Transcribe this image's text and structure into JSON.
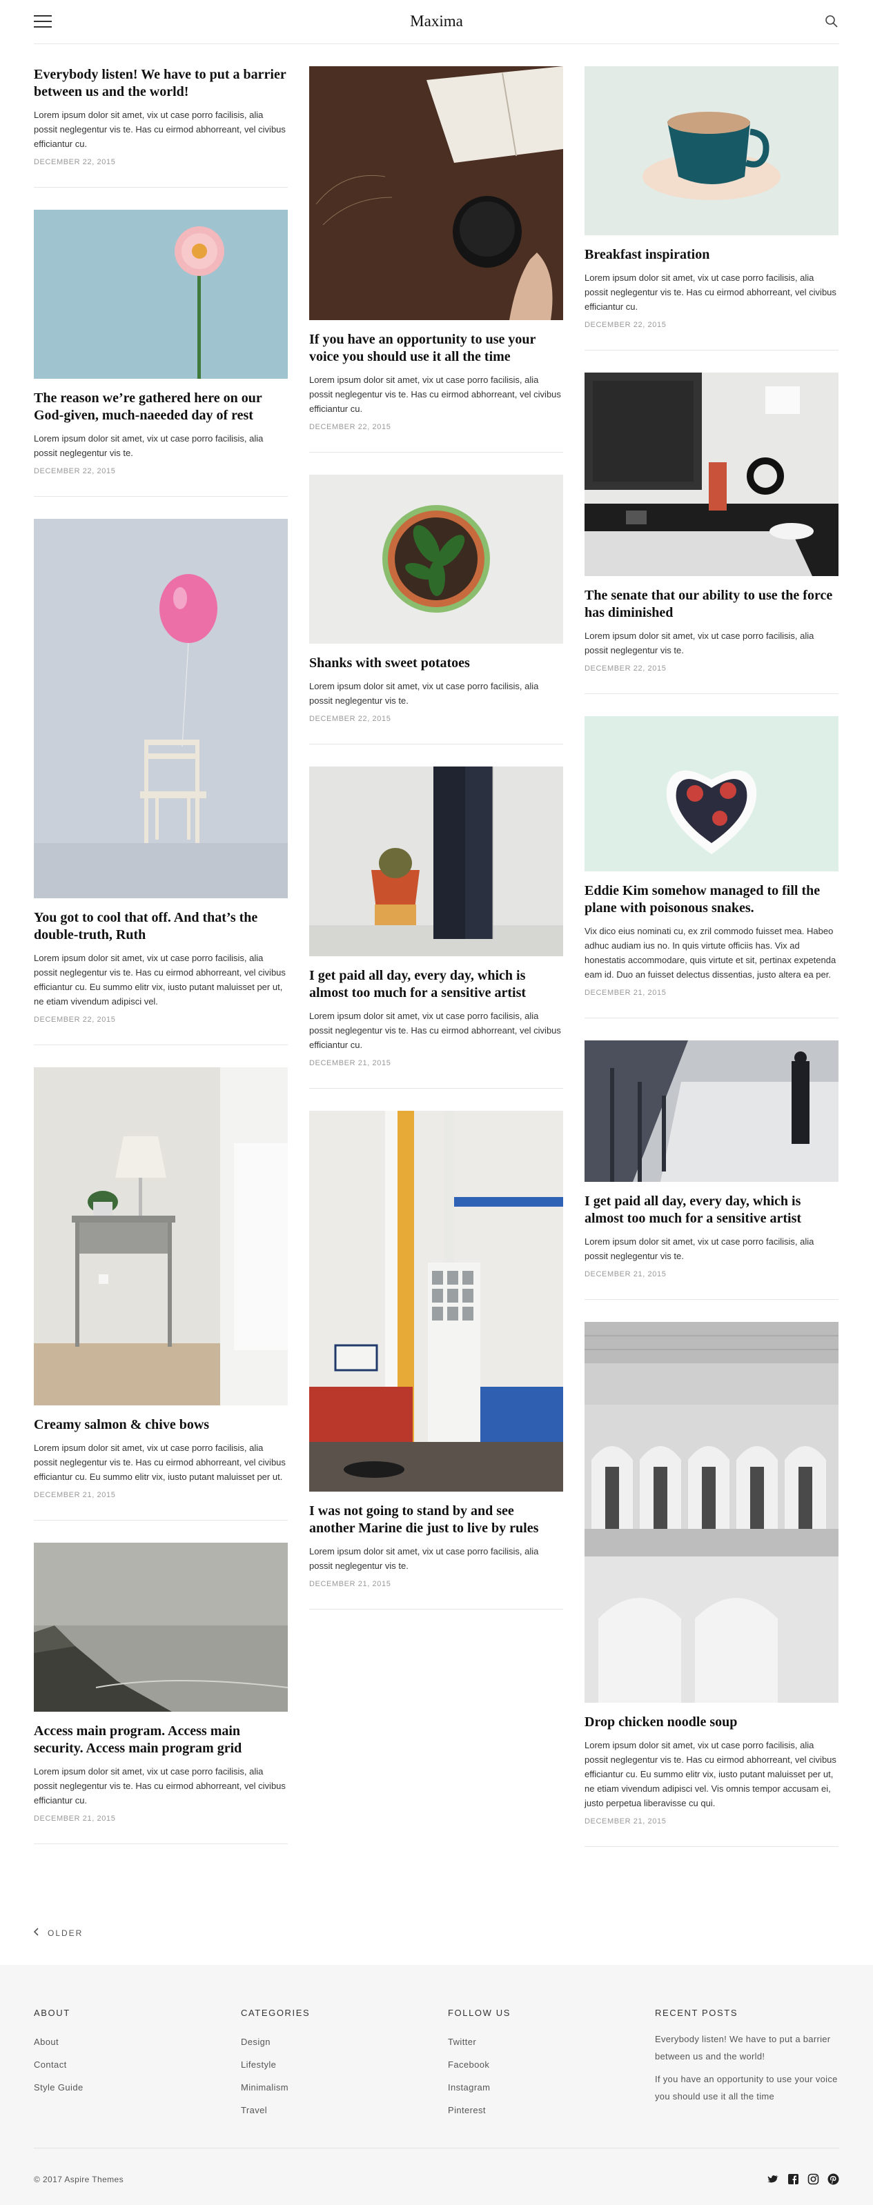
{
  "header": {
    "site_title": "Maxima",
    "menu_icon": "hamburger-menu-icon",
    "search_icon": "search-icon"
  },
  "posts": {
    "col1": [
      {
        "title": "Everybody listen! We have to put a barrier between us and the world!",
        "excerpt": "Lorem ipsum dolor sit amet, vix ut case porro facilisis, alia possit neglegentur vis te. Has cu eirmod abhorreant, vel civibus efficiantur cu.",
        "date": "December 22, 2015"
      },
      {
        "title": "The reason we’re gathered here on our God-given, much-naeeded day of rest",
        "excerpt": "Lorem ipsum dolor sit amet, vix ut case porro facilisis, alia possit neglegentur vis te.",
        "date": "December 22, 2015"
      },
      {
        "title": "You got to cool that off. And that’s the double-truth, Ruth",
        "excerpt": "Lorem ipsum dolor sit amet, vix ut case porro facilisis, alia possit neglegentur vis te. Has cu eirmod abhorreant, vel civibus efficiantur cu. Eu summo elitr vix, iusto putant maluisset per ut, ne etiam vivendum adipisci vel.",
        "date": "December 22, 2015"
      },
      {
        "title": "Creamy salmon & chive bows",
        "excerpt": "Lorem ipsum dolor sit amet, vix ut case porro facilisis, alia possit neglegentur vis te. Has cu eirmod abhorreant, vel civibus efficiantur cu. Eu summo elitr vix, iusto putant maluisset per ut.",
        "date": "December 21, 2015"
      },
      {
        "title": "Access main program. Access main security. Access main program grid",
        "excerpt": "Lorem ipsum dolor sit amet, vix ut case porro facilisis, alia possit neglegentur vis te. Has cu eirmod abhorreant, vel civibus efficiantur cu.",
        "date": "December 21, 2015"
      }
    ],
    "col2": [
      {
        "title": "If you have an opportunity to use your voice you should use it all the time",
        "excerpt": "Lorem ipsum dolor sit amet, vix ut case porro facilisis, alia possit neglegentur vis te. Has cu eirmod abhorreant, vel civibus efficiantur cu.",
        "date": "December 22, 2015"
      },
      {
        "title": "Shanks with sweet potatoes",
        "excerpt": "Lorem ipsum dolor sit amet, vix ut case porro facilisis, alia possit neglegentur vis te.",
        "date": "December 22, 2015"
      },
      {
        "title": "I get paid all day, every day, which is almost too much for a sensitive artist",
        "excerpt": "Lorem ipsum dolor sit amet, vix ut case porro facilisis, alia possit neglegentur vis te. Has cu eirmod abhorreant, vel civibus efficiantur cu.",
        "date": "December 21, 2015"
      },
      {
        "title": "I was not going to stand by and see another Marine die just to live by rules",
        "excerpt": "Lorem ipsum dolor sit amet, vix ut case porro facilisis, alia possit neglegentur vis te.",
        "date": "December 21, 2015"
      }
    ],
    "col3": [
      {
        "title": "Breakfast inspiration",
        "excerpt": "Lorem ipsum dolor sit amet, vix ut case porro facilisis, alia possit neglegentur vis te. Has cu eirmod abhorreant, vel civibus efficiantur cu.",
        "date": "December 22, 2015"
      },
      {
        "title": "The senate that our ability to use the force has diminished",
        "excerpt": "Lorem ipsum dolor sit amet, vix ut case porro facilisis, alia possit neglegentur vis te.",
        "date": "December 22, 2015"
      },
      {
        "title": "Eddie Kim somehow managed to fill the plane with poisonous snakes.",
        "excerpt": "Vix dico eius nominati cu, ex zril commodo fuisset mea. Habeo adhuc audiam ius no. In quis virtute officiis has. Vix ad honestatis accommodare, quis virtute et sit, pertinax expetenda eam id. Duo an fuisset delectus dissentias, justo altera ea per.",
        "date": "December 21, 2015"
      },
      {
        "title": "I get paid all day, every day, which is almost too much for a sensitive artist",
        "excerpt": "Lorem ipsum dolor sit amet, vix ut case porro facilisis, alia possit neglegentur vis te.",
        "date": "December 21, 2015"
      },
      {
        "title": "Drop chicken noodle soup",
        "excerpt": "Lorem ipsum dolor sit amet, vix ut case porro facilisis, alia possit neglegentur vis te. Has cu eirmod abhorreant, vel civibus efficiantur cu. Eu summo elitr vix, iusto putant maluisset per ut, ne etiam vivendum adipisci vel. Vis omnis tempor accusam ei, justo perpetua liberavisse cu qui.",
        "date": "December 21, 2015"
      }
    ]
  },
  "pagination": {
    "older_label": "OLDER"
  },
  "footer": {
    "about": {
      "heading": "ABOUT",
      "links": [
        "About",
        "Contact",
        "Style Guide"
      ]
    },
    "categories": {
      "heading": "CATEGORIES",
      "links": [
        "Design",
        "Lifestyle",
        "Minimalism",
        "Travel"
      ]
    },
    "follow": {
      "heading": "FOLLOW US",
      "links": [
        "Twitter",
        "Facebook",
        "Instagram",
        "Pinterest"
      ]
    },
    "recent": {
      "heading": "RECENT POSTS",
      "links": [
        "Everybody listen! We have to put a barrier between us and the world!",
        "If you have an opportunity to use your voice you should use it all the time"
      ]
    },
    "copyright": "© 2017 Aspire Themes",
    "social_icons": [
      "twitter-icon",
      "facebook-icon",
      "instagram-icon",
      "pinterest-icon"
    ]
  }
}
